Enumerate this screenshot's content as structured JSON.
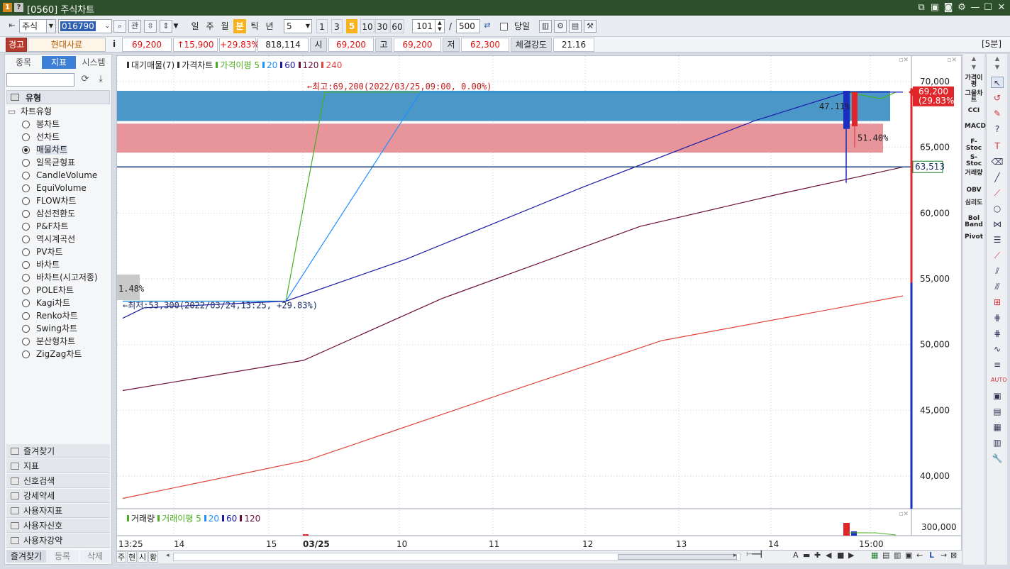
{
  "titlebar": {
    "icon1": "1",
    "icon2": "?",
    "title": "[0560] 주식차트"
  },
  "toolbar": {
    "market": "주식",
    "code": "016790",
    "link_label": "관",
    "periods": [
      "일",
      "주",
      "월",
      "분",
      "틱",
      "년"
    ],
    "selected_period": "분",
    "period_value": "5",
    "minute_buttons": [
      "1",
      "3",
      "5",
      "10",
      "30",
      "60"
    ],
    "selected_minute": "5",
    "count_value": "101",
    "count_sep": "/",
    "count_max": "500",
    "today_label": "당일"
  },
  "pricebar": {
    "warning_label": "경고",
    "name": "현대사료",
    "info_icon": "i",
    "price": "69,200",
    "change": "↑15,900",
    "change_pct": "+29.83%",
    "volume": "818,114",
    "open_label": "시",
    "open": "69,200",
    "high_label": "고",
    "high": "69,200",
    "low_label": "저",
    "low": "62,300",
    "strength_label": "체결강도",
    "strength": "21.16",
    "interval": "[5분]"
  },
  "leftpanel": {
    "tabs": [
      "종목",
      "지표",
      "시스템"
    ],
    "selected_tab": "지표",
    "section_title": "유형",
    "group_title": "차트유형",
    "chart_types": [
      "봉차트",
      "선차트",
      "매물차트",
      "일목균형표",
      "CandleVolume",
      "EquiVolume",
      "FLOW차트",
      "삼선전환도",
      "P&F차트",
      "역시계곡선",
      "PV차트",
      "바차트",
      "바차트(시고저종)",
      "POLE차트",
      "Kagi차트",
      "Renko차트",
      "Swing차트",
      "분산형차트",
      "ZigZag차트"
    ],
    "selected_type": "매물차트",
    "folders": [
      "즐겨찾기",
      "지표",
      "신호검색",
      "강세약세",
      "사용자지표",
      "사용자신호",
      "사용자강약"
    ],
    "bottom_buttons": [
      "즐겨찾기",
      "등록",
      "삭제"
    ]
  },
  "chart_data": {
    "type": "line",
    "legend": [
      {
        "label": "대기매물(7)",
        "color": "#333333"
      },
      {
        "label": "가격차트",
        "color": "#333333"
      },
      {
        "label": "가격이평 5",
        "color": "#4caf20"
      },
      {
        "label": "20",
        "color": "#1e90ff"
      },
      {
        "label": "60",
        "color": "#1a1aa8"
      },
      {
        "label": "120",
        "color": "#6b0f3a"
      },
      {
        "label": "240",
        "color": "#e0443c"
      }
    ],
    "ylim": [
      37000,
      71000
    ],
    "y_ticks": [
      "70,000",
      "65,000",
      "60,000",
      "55,000",
      "50,000",
      "45,000",
      "40,000"
    ],
    "x_ticks": [
      "13:25",
      "14",
      "15",
      "03/25",
      "10",
      "11",
      "12",
      "13",
      "14",
      "15:00"
    ],
    "volume_profile": [
      {
        "from": 67000,
        "to": 69300,
        "color": "#4a97c8"
      },
      {
        "from": 64600,
        "to": 66800,
        "color": "#e8949b"
      }
    ],
    "volume_profile_labels": [
      "47.11%",
      "51.40%",
      "1.48%"
    ],
    "max_annotation": "←최고:69,200(2022/03/25,09:00, 0.00%)",
    "min_annotation": "←최저:53,300(2022/03/24,13:25, +29.83%)",
    "horizontal_line": {
      "value": 63513,
      "label": "63,513"
    },
    "current_price_label": "69,200",
    "current_price_pct": "(29.83%)",
    "series": [
      {
        "name": "가격이평 5",
        "color": "#4caf20",
        "x": [
          0,
          230,
          285,
          1020,
          1070,
          1090
        ],
        "values": [
          53300,
          53300,
          69200,
          69200,
          68700,
          69200
        ]
      },
      {
        "name": "20",
        "color": "#1e90ff",
        "x": [
          0,
          230,
          420,
          1020,
          1100
        ],
        "values": [
          53300,
          53300,
          69200,
          69200,
          69200
        ]
      },
      {
        "name": "60",
        "color": "#1a1aa8",
        "x": [
          0,
          30,
          230,
          400,
          650,
          890,
          1020,
          1100
        ],
        "values": [
          52000,
          52800,
          53300,
          56500,
          62000,
          67000,
          69200,
          69200
        ]
      },
      {
        "name": "120",
        "color": "#6b0f3a",
        "x": [
          0,
          255,
          450,
          730,
          930,
          1100
        ],
        "values": [
          46500,
          48800,
          53500,
          59000,
          61500,
          63500
        ]
      },
      {
        "name": "240",
        "color": "#e0443c",
        "x": [
          0,
          260,
          380,
          560,
          760,
          1100
        ],
        "values": [
          38300,
          41200,
          43400,
          46700,
          50300,
          53700
        ]
      }
    ]
  },
  "volume_panel": {
    "legend": [
      "거래량",
      "거래이평 5",
      "20",
      "60",
      "120"
    ],
    "y_label": "300,000"
  },
  "rightstrip": [
    "가격이평",
    "그물차트",
    "CCI",
    "MACD",
    "F-Stoc",
    "S-Stoc",
    "거래량",
    "OBV",
    "심리도",
    "Bol Band",
    "Pivot"
  ],
  "bottombar": {
    "tabs": [
      "주",
      "현",
      "시",
      "황"
    ]
  }
}
